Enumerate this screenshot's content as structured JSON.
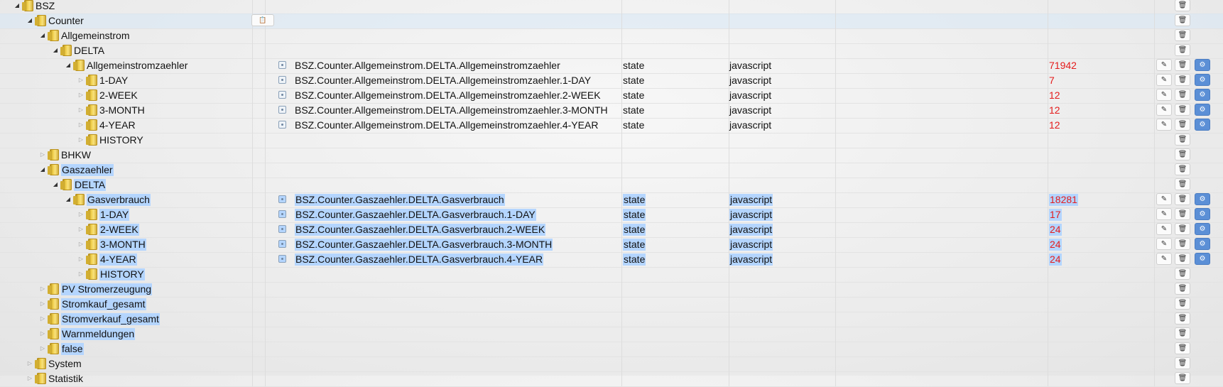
{
  "icons": {
    "folder": "folder-icon",
    "object": "object-state-icon",
    "edit": "pencil-icon",
    "delete": "trash-icon",
    "settings": "gear-icon",
    "clipboard": "clipboard-icon"
  },
  "colors": {
    "value": "#e41b1b",
    "selection": "#b4d5fe",
    "settings_button": "#5b8fd6"
  },
  "rows": [
    {
      "level": 0,
      "expanded": true,
      "label": "BSZ"
    },
    {
      "level": 1,
      "expanded": true,
      "label": "Counter",
      "highlight": true,
      "clip": true
    },
    {
      "level": 2,
      "expanded": true,
      "label": "Allgemeinstrom"
    },
    {
      "level": 3,
      "expanded": true,
      "label": "DELTA"
    },
    {
      "level": 4,
      "expanded": true,
      "label": "Allgemeinstromzaehler",
      "id": "BSZ.Counter.Allgemeinstrom.DELTA.Allgemeinstromzaehler",
      "type": "state",
      "role": "javascript",
      "value": "71942",
      "actions": true
    },
    {
      "level": 5,
      "expanded": false,
      "label": "1-DAY",
      "id": "BSZ.Counter.Allgemeinstrom.DELTA.Allgemeinstromzaehler.1-DAY",
      "type": "state",
      "role": "javascript",
      "value": "7",
      "actions": true
    },
    {
      "level": 5,
      "expanded": false,
      "label": "2-WEEK",
      "id": "BSZ.Counter.Allgemeinstrom.DELTA.Allgemeinstromzaehler.2-WEEK",
      "type": "state",
      "role": "javascript",
      "value": "12",
      "actions": true
    },
    {
      "level": 5,
      "expanded": false,
      "label": "3-MONTH",
      "id": "BSZ.Counter.Allgemeinstrom.DELTA.Allgemeinstromzaehler.3-MONTH",
      "type": "state",
      "role": "javascript",
      "value": "12",
      "actions": true
    },
    {
      "level": 5,
      "expanded": false,
      "label": "4-YEAR",
      "id": "BSZ.Counter.Allgemeinstrom.DELTA.Allgemeinstromzaehler.4-YEAR",
      "type": "state",
      "role": "javascript",
      "value": "12",
      "actions": true
    },
    {
      "level": 5,
      "expanded": false,
      "label": "HISTORY"
    },
    {
      "level": 2,
      "expanded": false,
      "label": "BHKW"
    },
    {
      "level": 2,
      "expanded": true,
      "label": "Gaszaehler",
      "selected": true
    },
    {
      "level": 3,
      "expanded": true,
      "label": "DELTA",
      "selected": true
    },
    {
      "level": 4,
      "expanded": true,
      "label": "Gasverbrauch",
      "selected": true,
      "id": "BSZ.Counter.Gaszaehler.DELTA.Gasverbrauch",
      "type": "state",
      "role": "javascript",
      "value": "18281",
      "actions": true
    },
    {
      "level": 5,
      "expanded": false,
      "label": "1-DAY",
      "selected": true,
      "id": "BSZ.Counter.Gaszaehler.DELTA.Gasverbrauch.1-DAY",
      "type": "state",
      "role": "javascript",
      "value": "17",
      "actions": true
    },
    {
      "level": 5,
      "expanded": false,
      "label": "2-WEEK",
      "selected": true,
      "id": "BSZ.Counter.Gaszaehler.DELTA.Gasverbrauch.2-WEEK",
      "type": "state",
      "role": "javascript",
      "value": "24",
      "actions": true
    },
    {
      "level": 5,
      "expanded": false,
      "label": "3-MONTH",
      "selected": true,
      "id": "BSZ.Counter.Gaszaehler.DELTA.Gasverbrauch.3-MONTH",
      "type": "state",
      "role": "javascript",
      "value": "24",
      "actions": true
    },
    {
      "level": 5,
      "expanded": false,
      "label": "4-YEAR",
      "selected": true,
      "id": "BSZ.Counter.Gaszaehler.DELTA.Gasverbrauch.4-YEAR",
      "type": "state",
      "role": "javascript",
      "value": "24",
      "actions": true
    },
    {
      "level": 5,
      "expanded": false,
      "label": "HISTORY",
      "selected": true
    },
    {
      "level": 2,
      "expanded": false,
      "label": "PV Stromerzeugung",
      "selected": true
    },
    {
      "level": 2,
      "expanded": false,
      "label": "Stromkauf_gesamt",
      "selected": true
    },
    {
      "level": 2,
      "expanded": false,
      "label": "Stromverkauf_gesamt",
      "selected": true
    },
    {
      "level": 2,
      "expanded": false,
      "label": "Warnmeldungen",
      "selected": true
    },
    {
      "level": 2,
      "expanded": false,
      "label": "false",
      "selected": true
    },
    {
      "level": 1,
      "expanded": false,
      "label": "System"
    },
    {
      "level": 1,
      "expanded": false,
      "label": "Statistik"
    }
  ]
}
